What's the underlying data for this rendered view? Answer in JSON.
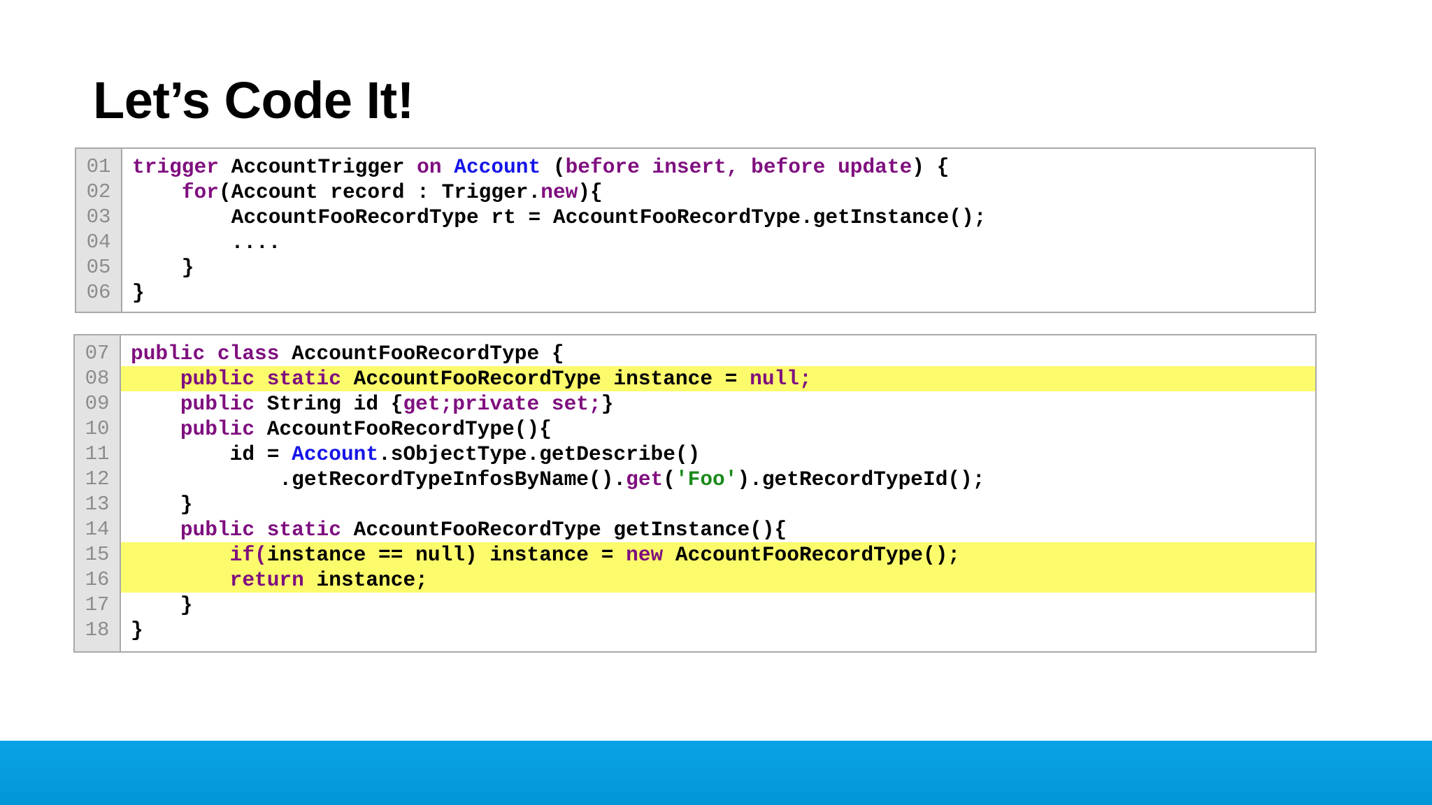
{
  "slide": {
    "title": "Let’s Code It!"
  },
  "colors": {
    "keyword": "#7f0f7f",
    "type": "#1414e8",
    "string": "#1a8a1a",
    "highlight": "#fbfb6c",
    "footer": "#0aa3e6"
  },
  "code_blocks": [
    {
      "lines": [
        {
          "num": "01",
          "highlight": false,
          "tokens": [
            {
              "t": "trigger",
              "k": "kw"
            },
            {
              "t": " AccountTrigger ",
              "k": "tx"
            },
            {
              "t": "on",
              "k": "kw"
            },
            {
              "t": " ",
              "k": "tx"
            },
            {
              "t": "Account",
              "k": "ty"
            },
            {
              "t": " (",
              "k": "tx"
            },
            {
              "t": "before insert, before update",
              "k": "kw"
            },
            {
              "t": ") {",
              "k": "tx"
            }
          ]
        },
        {
          "num": "02",
          "highlight": false,
          "tokens": [
            {
              "t": "    ",
              "k": "tx"
            },
            {
              "t": "for",
              "k": "kw"
            },
            {
              "t": "(Account record : Trigger.",
              "k": "tx"
            },
            {
              "t": "new",
              "k": "kw"
            },
            {
              "t": "){",
              "k": "tx"
            }
          ]
        },
        {
          "num": "03",
          "highlight": false,
          "tokens": [
            {
              "t": "        AccountFooRecordType rt = AccountFooRecordType.getInstance();",
              "k": "tx"
            }
          ]
        },
        {
          "num": "04",
          "highlight": false,
          "tokens": [
            {
              "t": "        ....",
              "k": "tx"
            }
          ]
        },
        {
          "num": "05",
          "highlight": false,
          "tokens": [
            {
              "t": "    }",
              "k": "tx"
            }
          ]
        },
        {
          "num": "06",
          "highlight": false,
          "tokens": [
            {
              "t": "}",
              "k": "tx"
            }
          ]
        }
      ]
    },
    {
      "lines": [
        {
          "num": "07",
          "highlight": false,
          "tokens": [
            {
              "t": "public class",
              "k": "kw"
            },
            {
              "t": " AccountFooRecordType {",
              "k": "tx"
            }
          ]
        },
        {
          "num": "08",
          "highlight": true,
          "tokens": [
            {
              "t": "    ",
              "k": "tx"
            },
            {
              "t": "public static",
              "k": "kw"
            },
            {
              "t": " AccountFooRecordType instance = ",
              "k": "tx"
            },
            {
              "t": "null;",
              "k": "kw"
            }
          ]
        },
        {
          "num": "09",
          "highlight": false,
          "tokens": [
            {
              "t": "    ",
              "k": "tx"
            },
            {
              "t": "public",
              "k": "kw"
            },
            {
              "t": " String id {",
              "k": "tx"
            },
            {
              "t": "get;private set;",
              "k": "kw"
            },
            {
              "t": "}",
              "k": "tx"
            }
          ]
        },
        {
          "num": "10",
          "highlight": false,
          "tokens": [
            {
              "t": "    ",
              "k": "tx"
            },
            {
              "t": "public",
              "k": "kw"
            },
            {
              "t": " AccountFooRecordType(){",
              "k": "tx"
            }
          ]
        },
        {
          "num": "11",
          "highlight": false,
          "tokens": [
            {
              "t": "        id = ",
              "k": "tx"
            },
            {
              "t": "Account",
              "k": "ty"
            },
            {
              "t": ".sObjectType.getDescribe()",
              "k": "tx"
            }
          ]
        },
        {
          "num": "12",
          "highlight": false,
          "tokens": [
            {
              "t": "            .getRecordTypeInfosByName().",
              "k": "tx"
            },
            {
              "t": "get",
              "k": "kw"
            },
            {
              "t": "(",
              "k": "tx"
            },
            {
              "t": "'Foo'",
              "k": "st"
            },
            {
              "t": ").getRecordTypeId();",
              "k": "tx"
            }
          ]
        },
        {
          "num": "13",
          "highlight": false,
          "tokens": [
            {
              "t": "    }",
              "k": "tx"
            }
          ]
        },
        {
          "num": "14",
          "highlight": false,
          "tokens": [
            {
              "t": "    ",
              "k": "tx"
            },
            {
              "t": "public static",
              "k": "kw"
            },
            {
              "t": " AccountFooRecordType getInstance(){",
              "k": "tx"
            }
          ]
        },
        {
          "num": "15",
          "highlight": true,
          "tokens": [
            {
              "t": "        ",
              "k": "tx"
            },
            {
              "t": "if(",
              "k": "kw"
            },
            {
              "t": "instance == null) instance = ",
              "k": "tx"
            },
            {
              "t": "new",
              "k": "kw"
            },
            {
              "t": " AccountFooRecordType();",
              "k": "tx"
            }
          ]
        },
        {
          "num": "16",
          "highlight": true,
          "tokens": [
            {
              "t": "        ",
              "k": "tx"
            },
            {
              "t": "return",
              "k": "kw"
            },
            {
              "t": " instance;",
              "k": "tx"
            }
          ]
        },
        {
          "num": "17",
          "highlight": false,
          "tokens": [
            {
              "t": "    }",
              "k": "tx"
            }
          ]
        },
        {
          "num": "18",
          "highlight": false,
          "tokens": [
            {
              "t": "}",
              "k": "tx"
            }
          ]
        }
      ]
    }
  ]
}
